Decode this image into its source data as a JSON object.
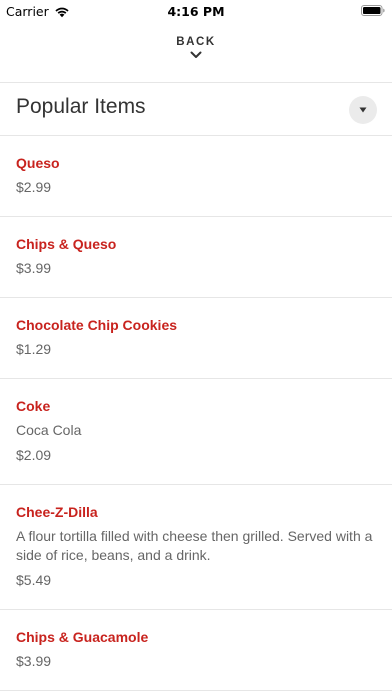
{
  "status_bar": {
    "carrier": "Carrier",
    "time": "4:16 PM",
    "wifi_icon": "wifi-icon",
    "battery_icon": "battery-icon"
  },
  "header": {
    "back_label": "BACK",
    "back_icon": "chevron-down-icon"
  },
  "section": {
    "title": "Popular Items",
    "dropdown_icon": "caret-down-icon"
  },
  "items": [
    {
      "name": "Queso",
      "description": "",
      "price": "$2.99"
    },
    {
      "name": "Chips & Queso",
      "description": "",
      "price": "$3.99"
    },
    {
      "name": "Chocolate Chip Cookies",
      "description": "",
      "price": "$1.29"
    },
    {
      "name": "Coke",
      "description": "Coca Cola",
      "price": "$2.09"
    },
    {
      "name": "Chee-Z-Dilla",
      "description": "A flour tortilla filled with cheese then grilled. Served with a side of rice, beans, and a drink.",
      "price": "$5.49"
    },
    {
      "name": "Chips & Guacamole",
      "description": "",
      "price": "$3.99"
    }
  ],
  "colors": {
    "accent": "#c8231e",
    "text": "#333333",
    "muted": "#666666",
    "divider": "#e6e6e6"
  }
}
